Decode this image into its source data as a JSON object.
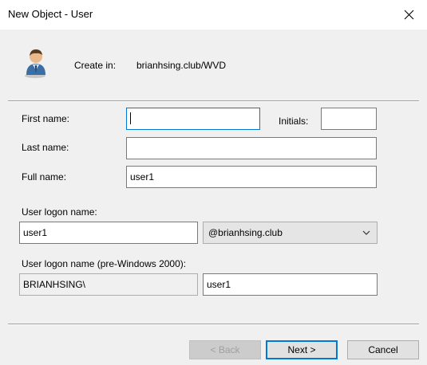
{
  "window": {
    "title": "New Object - User"
  },
  "header": {
    "create_in_label": "Create in:",
    "create_in_path": "brianhsing.club/WVD",
    "icon": "user-icon"
  },
  "form": {
    "first_name": {
      "label": "First name:",
      "value": ""
    },
    "initials": {
      "label": "Initials:",
      "value": ""
    },
    "last_name": {
      "label": "Last name:",
      "value": ""
    },
    "full_name": {
      "label": "Full name:",
      "value": "user1"
    },
    "logon": {
      "label": "User logon name:",
      "value": "user1",
      "domain": "@brianhsing.club"
    },
    "pre2000": {
      "label": "User logon name (pre-Windows 2000):",
      "domain": "BRIANHSING\\",
      "value": "user1"
    }
  },
  "buttons": {
    "back": "< Back",
    "next": "Next >",
    "cancel": "Cancel"
  },
  "colors": {
    "focus": "#0078d7",
    "dialog_bg": "#f0f0f0"
  }
}
